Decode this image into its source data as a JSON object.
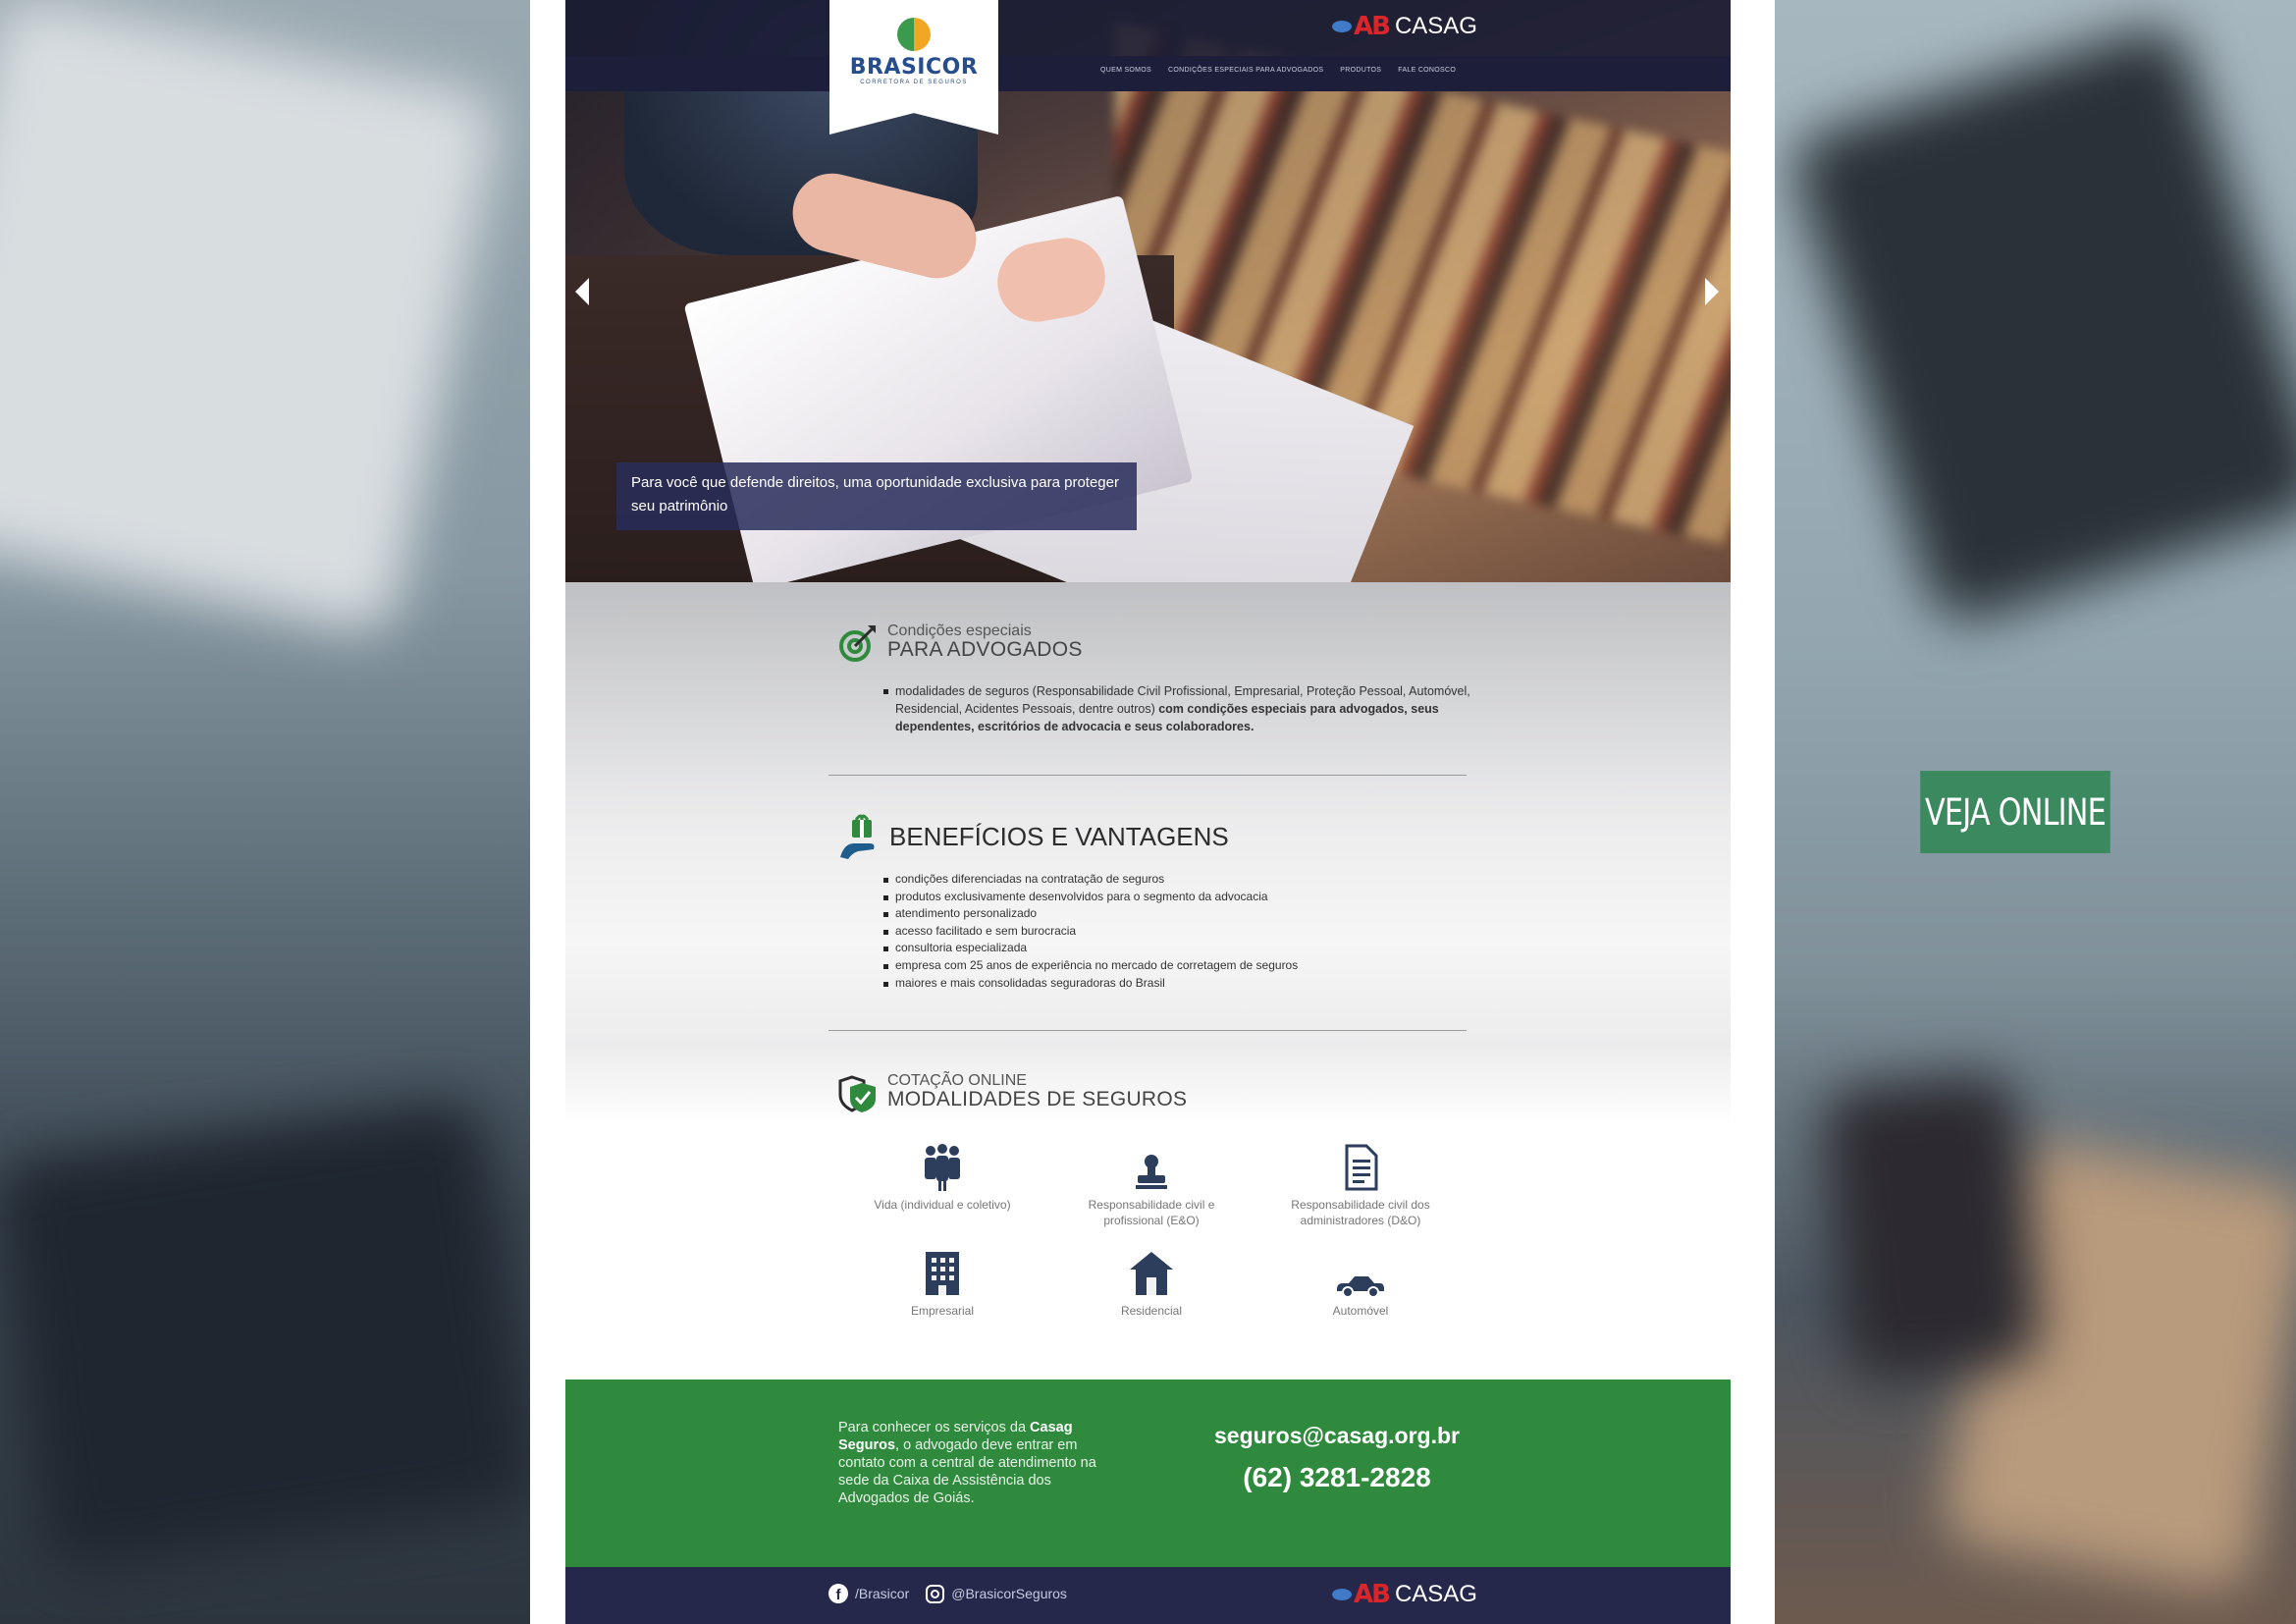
{
  "veja_online": "VEJA ONLINE",
  "header": {
    "brand": "BRASICOR",
    "brand_sub": "CORRETORA DE SEGUROS",
    "partner": "CASAG",
    "partner_mark": "AB",
    "nav": [
      "QUEM SOMOS",
      "CONDIÇÕES ESPECIAIS PARA ADVOGADOS",
      "PRODUTOS",
      "FALE CONOSCO"
    ]
  },
  "hero": {
    "caption": "Para você que defende direitos, uma oportunidade exclusiva para proteger seu patrimônio"
  },
  "conditions": {
    "title_small": "Condições especiais",
    "title_big": "PARA ADVOGADOS",
    "text_normal": "modalidades de seguros (Responsabilidade Civil Profissional, Empresarial, Proteção Pessoal, Automóvel, Residencial, Acidentes Pessoais, dentre outros) ",
    "text_bold": "com condições especiais para advogados, seus dependentes, escritórios de advocacia e seus colaboradores."
  },
  "benefits": {
    "title": "BENEFÍCIOS E VANTAGENS",
    "items": [
      "condições diferenciadas na contratação de seguros",
      "produtos exclusivamente desenvolvidos para o segmento da advocacia",
      "atendimento personalizado",
      "acesso facilitado e sem burocracia",
      "consultoria especializada",
      "empresa com 25 anos de experiência no mercado de corretagem de seguros",
      "maiores e mais consolidadas seguradoras do Brasil"
    ]
  },
  "quote": {
    "title_small": "COTAÇÃO ONLINE",
    "title_big": "MODALIDADES DE SEGUROS",
    "items": [
      {
        "label": "Vida (individual e coletivo)",
        "icon": "people-icon"
      },
      {
        "label": "Responsabilidade civil e profissional (E&O)",
        "icon": "stamp-icon"
      },
      {
        "label": "Responsabilidade civil dos administradores (D&O)",
        "icon": "document-icon"
      },
      {
        "label": "Empresarial",
        "icon": "building-icon"
      },
      {
        "label": "Residencial",
        "icon": "house-icon"
      },
      {
        "label": "Automóvel",
        "icon": "car-icon"
      }
    ]
  },
  "contact": {
    "text_pre": "Para conhecer os serviços da ",
    "text_bold": "Casag Seguros",
    "text_post": ", o advogado deve entrar em contato com a central de atendimento na sede da Caixa de Assistência dos Advogados de Goiás.",
    "email": "seguros@casag.org.br",
    "phone": "(62) 3281-2828"
  },
  "footer": {
    "facebook": "/Brasicor",
    "instagram": "@BrasicorSeguros",
    "partner": "CASAG",
    "partner_mark": "AB"
  },
  "colors": {
    "accent_green": "#2f8a3e",
    "navy": "#25284a",
    "veja_green": "#3b8a5f"
  }
}
